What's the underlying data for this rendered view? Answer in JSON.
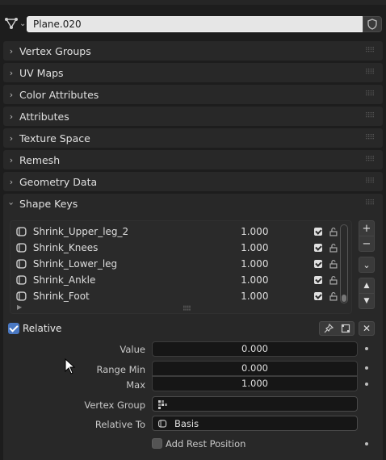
{
  "header": {
    "object_name": "Plane.020",
    "mesh_icon": "mesh-data-icon",
    "fake_user_icon": "shield-icon"
  },
  "panels": [
    {
      "label": "Vertex Groups",
      "expanded": false
    },
    {
      "label": "UV Maps",
      "expanded": false
    },
    {
      "label": "Color Attributes",
      "expanded": false
    },
    {
      "label": "Attributes",
      "expanded": false
    },
    {
      "label": "Texture Space",
      "expanded": false
    },
    {
      "label": "Remesh",
      "expanded": false
    },
    {
      "label": "Geometry Data",
      "expanded": false
    },
    {
      "label": "Shape Keys",
      "expanded": true
    }
  ],
  "shape_keys": {
    "items": [
      {
        "name": "Shrink_Upper_leg_2",
        "value": "1.000",
        "enabled": true
      },
      {
        "name": "Shrink_Knees",
        "value": "1.000",
        "enabled": true
      },
      {
        "name": "Shrink_Lower_leg",
        "value": "1.000",
        "enabled": true
      },
      {
        "name": "Shrink_Ankle",
        "value": "1.000",
        "enabled": true
      },
      {
        "name": "Shrink_Foot",
        "value": "1.000",
        "enabled": true
      }
    ],
    "side_buttons": {
      "add": "+",
      "remove": "−",
      "specials": "⌄",
      "move_up": "▲",
      "move_down": "▼"
    },
    "relative": {
      "label": "Relative",
      "checked": true
    },
    "close_glyph": "✕",
    "properties": {
      "value_label": "Value",
      "value": "0.000",
      "range_min_label": "Range Min",
      "range_min": "0.000",
      "max_label": "Max",
      "max": "1.000",
      "vertex_group_label": "Vertex Group",
      "vertex_group": "",
      "relative_to_label": "Relative To",
      "relative_to": "Basis",
      "add_rest_position_label": "Add Rest Position",
      "add_rest_position": false
    }
  },
  "colors": {
    "background": "#1d1d1d",
    "panel": "#282828",
    "accent": "#4a78c2",
    "field": "#161616"
  }
}
